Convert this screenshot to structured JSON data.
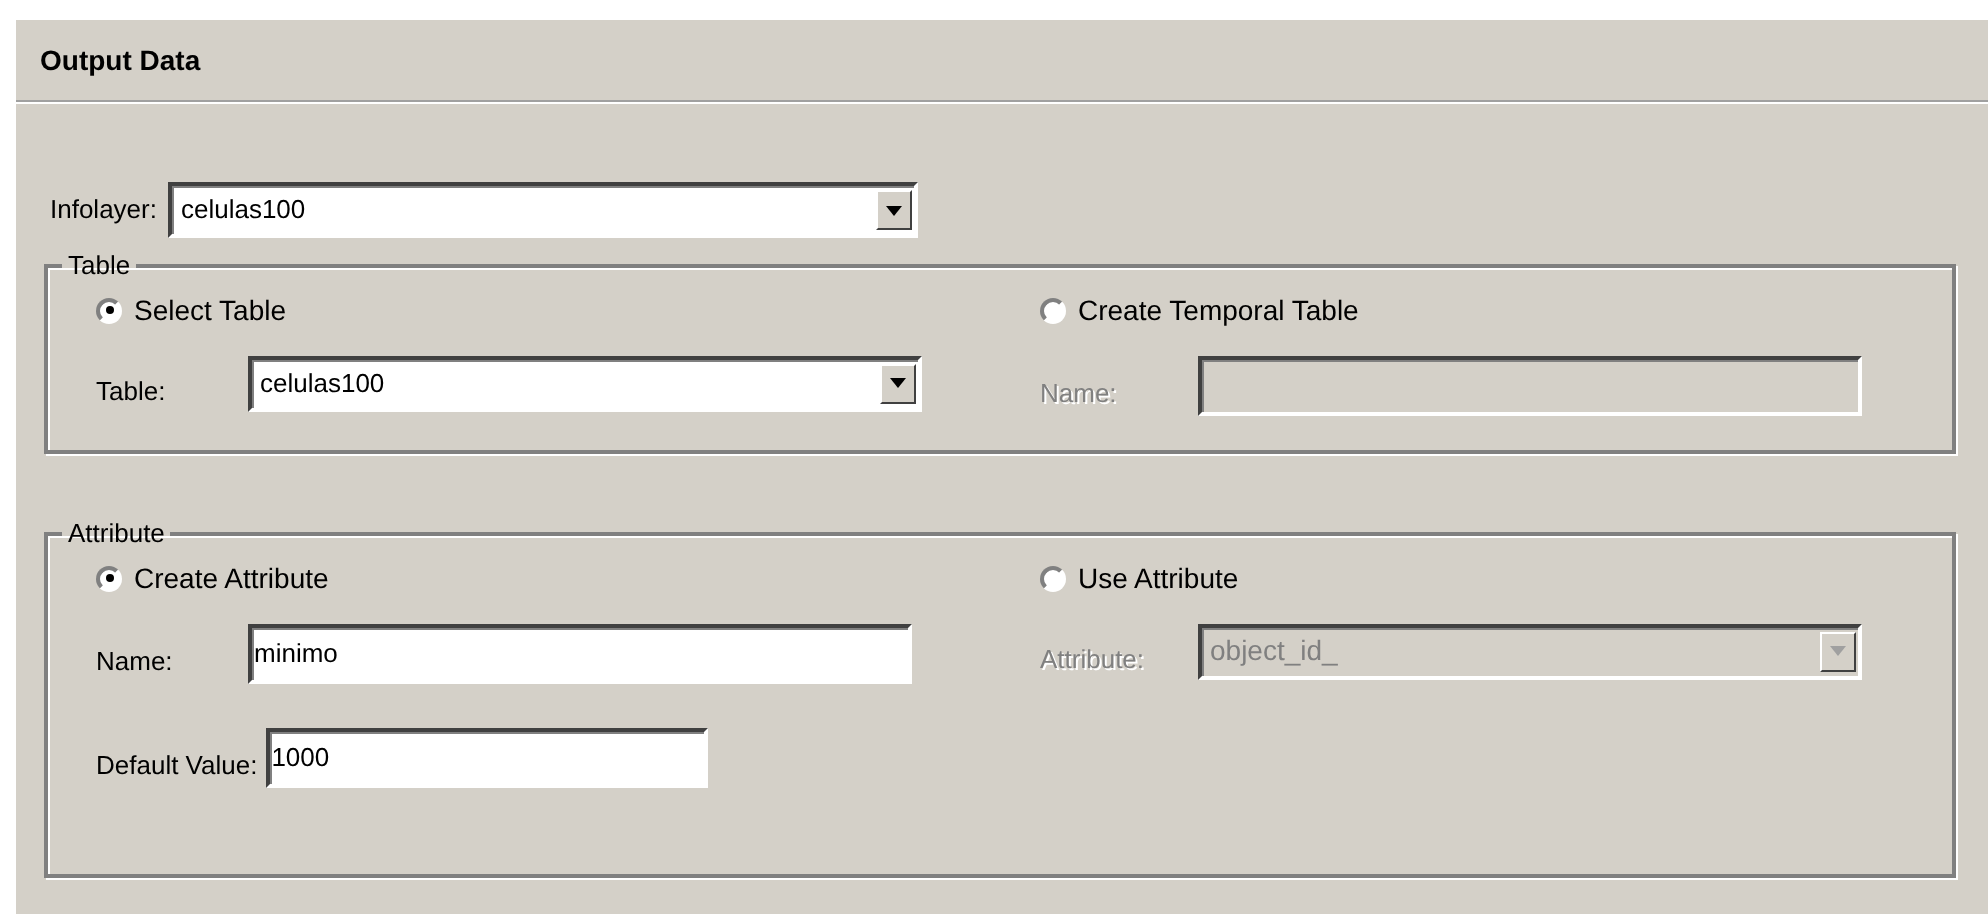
{
  "section": {
    "title": "Output Data"
  },
  "infolayer": {
    "label": "Infolayer:",
    "value": "celulas100"
  },
  "groups": [
    {
      "title": "Table",
      "options": [
        {
          "label": "Select Table",
          "selected": true,
          "fields": [
            {
              "kind": "combo",
              "label": "Table:",
              "value": "celulas100",
              "disabled": false
            }
          ]
        },
        {
          "label": "Create Temporal Table",
          "selected": false,
          "fields": [
            {
              "kind": "text",
              "label": "Name:",
              "disabled": true
            }
          ]
        }
      ]
    },
    {
      "title": "Attribute",
      "options": [
        {
          "label": "Create Attribute",
          "selected": true,
          "fields": [
            {
              "kind": "text",
              "label": "Name:",
              "value": "minimo",
              "disabled": false
            },
            {
              "kind": "text",
              "label": "Default Value:",
              "value": "1000",
              "disabled": false
            }
          ]
        },
        {
          "label": "Use Attribute",
          "selected": false,
          "fields": [
            {
              "kind": "combo",
              "label": "Attribute:",
              "value": "object_id_",
              "disabled": true
            }
          ]
        }
      ]
    }
  ]
}
